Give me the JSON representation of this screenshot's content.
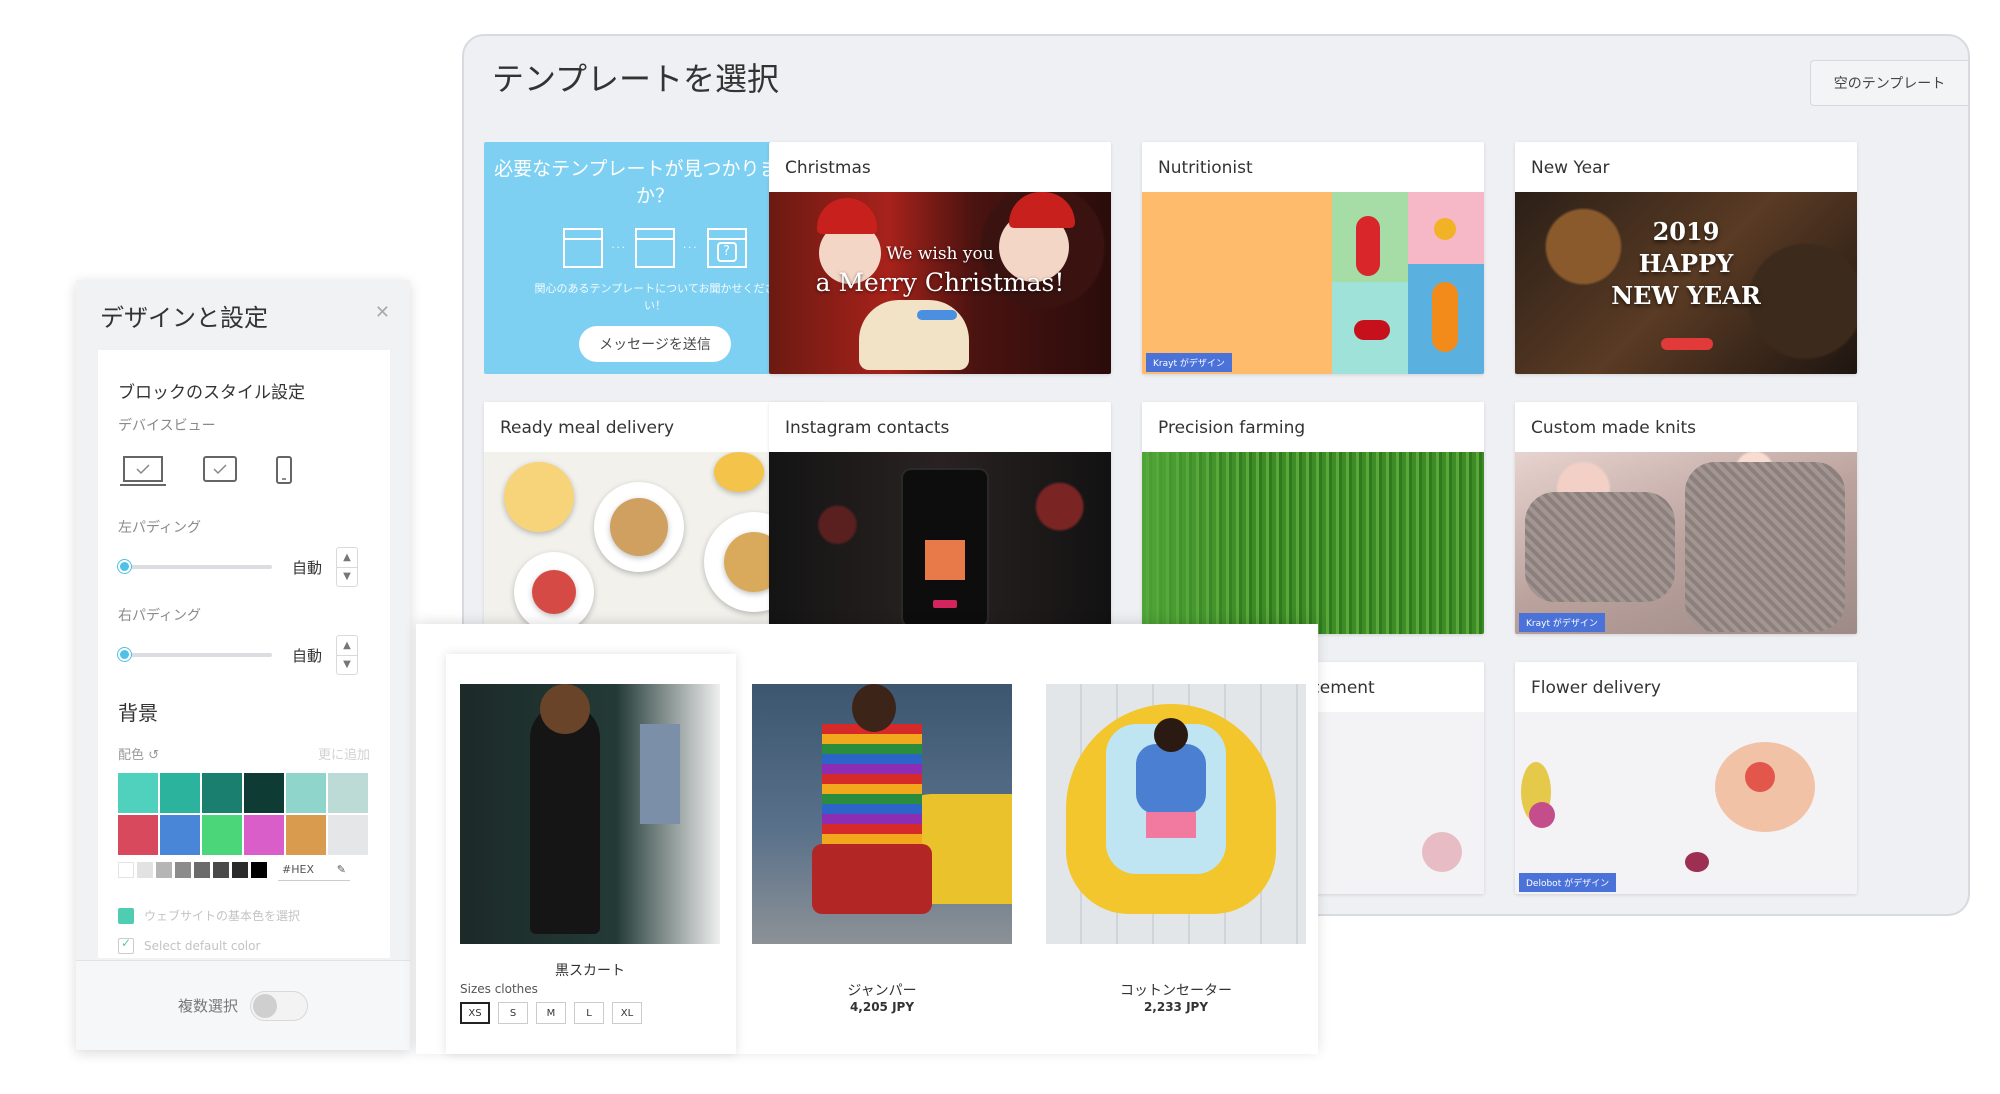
{
  "template_picker": {
    "title": "テンプレートを選択",
    "blank_button": "空のテンプレート",
    "cta": {
      "title": "必要なテンプレートが見つかりませんか？",
      "subtitle": "関心のあるテンプレートについてお聞かせください！",
      "button": "メッセージを送信"
    },
    "cards": [
      {
        "title": "Christmas",
        "art_text_1": "We wish you",
        "art_text_2": "a Merry Christmas!"
      },
      {
        "title": "Nutritionist",
        "badge": "Krayt がデザイン"
      },
      {
        "title": "New Year",
        "art_text_1": "2019",
        "art_text_2": "HAPPY",
        "art_text_3": "NEW YEAR"
      },
      {
        "title": "Ready meal delivery"
      },
      {
        "title": "Instagram contacts"
      },
      {
        "title": "Precision farming"
      },
      {
        "title": "Custom made knits",
        "badge": "Krayt がデザイン"
      },
      {
        "title": "e channel announcement"
      },
      {
        "title": "Flower delivery",
        "badge": "Delobot がデザイン"
      }
    ]
  },
  "design_panel": {
    "title": "デザインと設定",
    "block_style_title": "ブロックのスタイル設定",
    "device_view_label": "デバイスビュー",
    "devices": [
      "desktop",
      "tablet",
      "mobile"
    ],
    "left_padding": {
      "label": "左パディング",
      "value": "自動",
      "level": 0
    },
    "right_padding": {
      "label": "右パディング",
      "value": "自動",
      "level": 0
    },
    "background_title": "背景",
    "color_label": "配色",
    "add_label": "更に追加",
    "swatches": [
      "#4fd1be",
      "#2bb39e",
      "#1a7f6e",
      "#0f3b35",
      "#8fd5cb",
      "#bcdad6",
      "#d9495e",
      "#4a86d8",
      "#4cd67a",
      "#d95ec9",
      "#d99c4e",
      "#e4e6e7"
    ],
    "grays": [
      "#ffffff",
      "#e2e2e2",
      "#b5b5b5",
      "#8c8c8c",
      "#6b6b6b",
      "#4a4a4a",
      "#2a2a2a",
      "#000000"
    ],
    "hex_label": "#HEX",
    "website_color_label": "ウェブサイトの基本色を選択",
    "default_color_label": "Select default color",
    "multi_select_label": "複数選択"
  },
  "products": {
    "items": [
      {
        "name": "黒スカート",
        "sizes_label": "Sizes clothes",
        "sizes": [
          "XS",
          "S",
          "M",
          "L",
          "XL"
        ],
        "active_size": "XS"
      },
      {
        "name": "ジャンパー",
        "price": "4,205 JPY"
      },
      {
        "name": "コットンセーター",
        "price": "2,233 JPY"
      }
    ]
  }
}
